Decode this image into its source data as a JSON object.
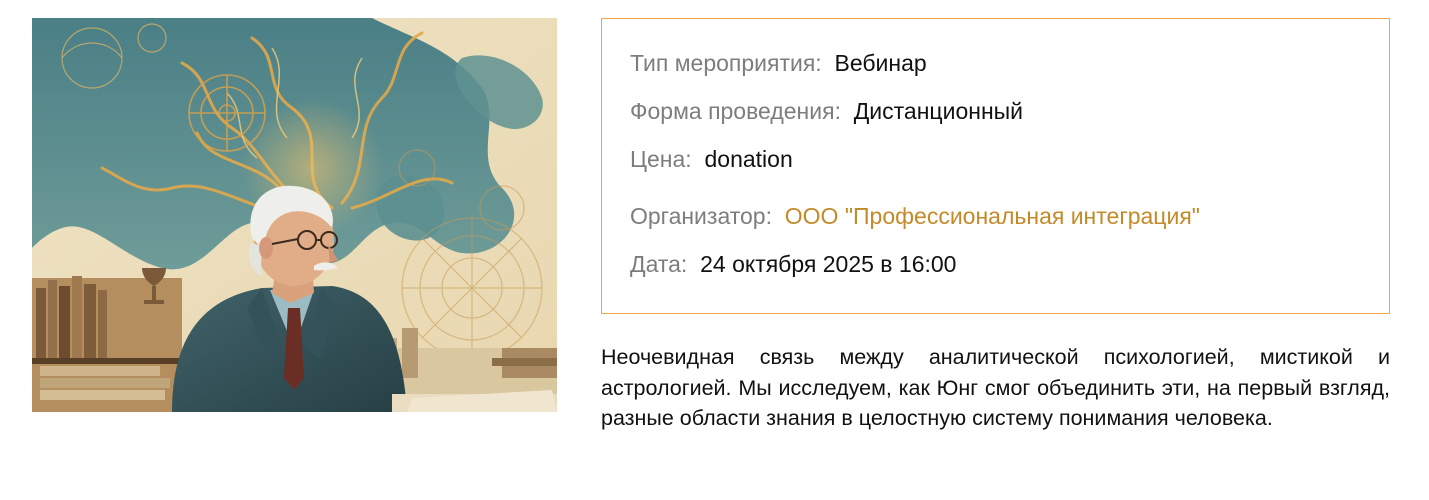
{
  "event": {
    "image": {
      "alt": "",
      "icon": "event-illustration"
    },
    "details": {
      "type_label": "Тип мероприятия:",
      "type_value": "Вебинар",
      "format_label": "Форма проведения:",
      "format_value": "Дистанционный",
      "price_label": "Цена:",
      "price_value": "donation",
      "organizer_label": "Организатор:",
      "organizer_value": "ООО \"Профессиональная интеграция\"",
      "date_label": "Дата:",
      "date_value": "24 октября 2025 в 16:00"
    },
    "description": "Неочевидная связь между аналитической психологией, мистикой и астрологией. Мы исследуем, как Юнг смог объединить эти, на первый взгляд, разные области знания в целостную систему понимания человека."
  },
  "colors": {
    "accent_border": "#f0a646",
    "link": "#c48a28",
    "label": "#7d7d7d",
    "text": "#111111"
  }
}
